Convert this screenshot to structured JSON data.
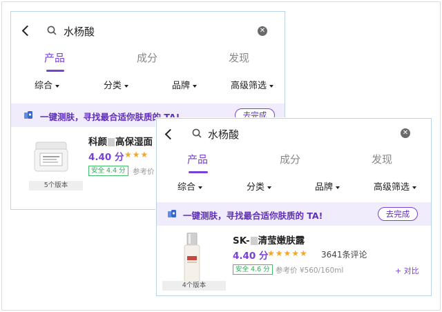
{
  "search": {
    "query": "水杨酸",
    "clear_icon": "clear-icon"
  },
  "tabs": [
    {
      "label": "产品",
      "active": true
    },
    {
      "label": "成分",
      "active": false
    },
    {
      "label": "发现",
      "active": false
    }
  ],
  "filters": [
    {
      "label": "综合"
    },
    {
      "label": "分类"
    },
    {
      "label": "品牌"
    },
    {
      "label": "高级筛选"
    }
  ],
  "banner": {
    "text": "一键测肤，寻找最合适你肤质的 TA!",
    "button": "去完成"
  },
  "back_panel": {
    "product": {
      "name_prefix": "科颜",
      "name_suffix": "高保湿面",
      "score": "4.40 分",
      "stars": "★★★",
      "safety": "安全 4.4 分",
      "ref_price": "参考价",
      "versions": "5个版本"
    }
  },
  "front_panel": {
    "product": {
      "name_prefix": "SK-",
      "name_suffix": "清莹嫩肤露",
      "score": "4.40 分",
      "stars": "★★★★★",
      "reviews": "3641条评论",
      "safety": "安全 4.6 分",
      "ref_price": "参考价 ¥560/160ml",
      "compare": "+ 对比",
      "versions": "4个版本"
    }
  },
  "colors": {
    "accent": "#7a3fd6",
    "banner_bg": "#f1ecfb",
    "safe_green": "#2faa58",
    "star": "#f5a623"
  }
}
